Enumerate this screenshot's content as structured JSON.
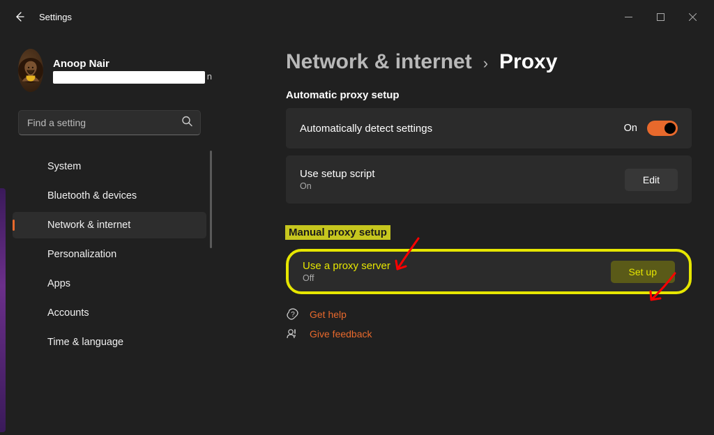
{
  "app": {
    "title": "Settings"
  },
  "user": {
    "name": "Anoop Nair"
  },
  "search": {
    "placeholder": "Find a setting"
  },
  "nav": {
    "items": [
      {
        "label": "System"
      },
      {
        "label": "Bluetooth & devices"
      },
      {
        "label": "Network & internet",
        "active": true
      },
      {
        "label": "Personalization"
      },
      {
        "label": "Apps"
      },
      {
        "label": "Accounts"
      },
      {
        "label": "Time & language"
      }
    ]
  },
  "breadcrumb": {
    "parent": "Network & internet",
    "sep": "›",
    "current": "Proxy"
  },
  "sections": {
    "auto": {
      "title": "Automatic proxy setup",
      "detect": {
        "label": "Automatically detect settings",
        "state_label": "On",
        "state": true
      },
      "script": {
        "label": "Use setup script",
        "sub": "On",
        "button": "Edit"
      }
    },
    "manual": {
      "title": "Manual proxy setup",
      "proxy": {
        "label": "Use a proxy server",
        "sub": "Off",
        "button": "Set up"
      }
    }
  },
  "links": {
    "help": "Get help",
    "feedback": "Give feedback"
  }
}
